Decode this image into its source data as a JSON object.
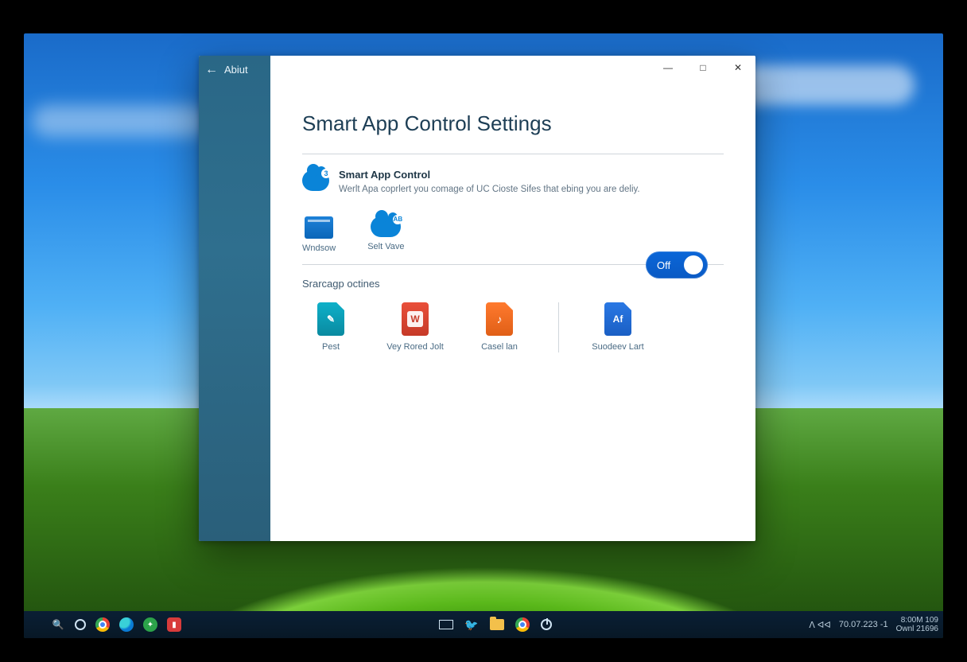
{
  "sidebar": {
    "back_glyph": "←",
    "title": "Abiut"
  },
  "window_controls": {
    "minimize": "—",
    "maximize": "□",
    "close": "✕"
  },
  "page": {
    "title": "Smart App Control Settings"
  },
  "smart_app": {
    "heading": "Smart App Control",
    "description": "Werlt Apa coprlert you comage of UC Cioste Sifes that ebing you are deliy.",
    "cloud_badge": "3"
  },
  "row_icons": {
    "item1_label": "Wndsow",
    "item2_label": "Selt Vave",
    "item2_badge": "AB"
  },
  "toggle": {
    "label": "Off",
    "state": "off"
  },
  "startup": {
    "heading": "Srarcagp octines",
    "items": [
      {
        "label": "Pest",
        "color": "teal",
        "glyph": "✎"
      },
      {
        "label": "Vey Rored Jolt",
        "color": "red",
        "glyph": "W"
      },
      {
        "label": "Casel lan",
        "color": "orange",
        "glyph": "♪"
      },
      {
        "label": "Suodeev Lart",
        "color": "blue",
        "glyph": "Af"
      }
    ]
  },
  "taskbar": {
    "tray_text": "ᐱ  ᐊᐊ",
    "clock_main": "70.07.223 -1",
    "clock_line1": "8:00M  109",
    "clock_line2": "Ownl  21696"
  }
}
